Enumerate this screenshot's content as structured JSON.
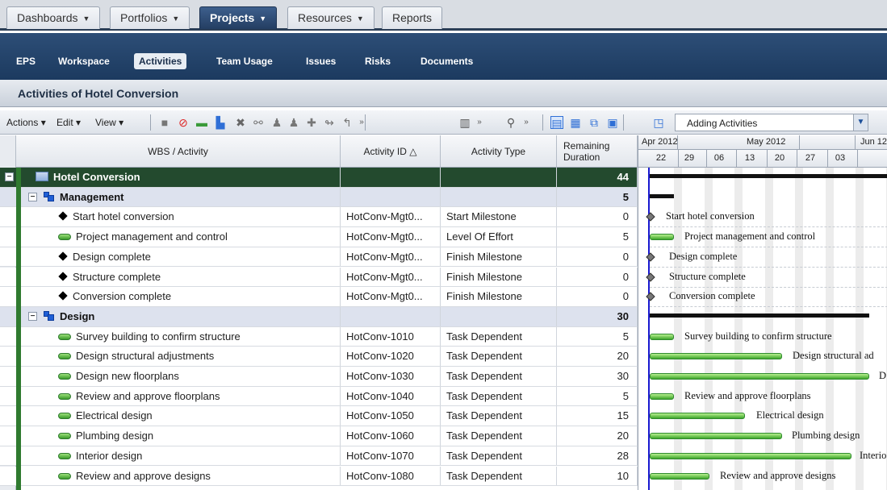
{
  "top_tabs": [
    {
      "label": "Dashboards",
      "caret": "▼"
    },
    {
      "label": "Portfolios",
      "caret": "▼"
    },
    {
      "label": "Projects",
      "caret": "▼"
    },
    {
      "label": "Resources",
      "caret": "▼"
    },
    {
      "label": "Reports",
      "caret": ""
    }
  ],
  "sub_nav": [
    "EPS",
    "Workspace",
    "Activities",
    "Team Usage",
    "Issues",
    "Risks",
    "Documents"
  ],
  "page_title": "Activities of Hotel Conversion",
  "toolbar": {
    "actions": "Actions",
    "edit": "Edit",
    "view": "View",
    "layout_value": "Adding Activities"
  },
  "columns": {
    "wbs": "WBS / Activity",
    "id": "Activity ID △",
    "type": "Activity Type",
    "rem": "Remaining Duration"
  },
  "rows": [
    {
      "kind": "project",
      "name": "Hotel Conversion",
      "id": "",
      "type": "",
      "dur": "44"
    },
    {
      "kind": "wbs",
      "name": "Management",
      "id": "",
      "type": "",
      "dur": "5"
    },
    {
      "kind": "ms",
      "name": "Start hotel conversion",
      "id": "HotConv-Mgt0...",
      "type": "Start Milestone",
      "dur": "0"
    },
    {
      "kind": "task",
      "name": "Project management and control",
      "id": "HotConv-Mgt0...",
      "type": "Level Of Effort",
      "dur": "5"
    },
    {
      "kind": "ms",
      "name": "Design complete",
      "id": "HotConv-Mgt0...",
      "type": "Finish Milestone",
      "dur": "0"
    },
    {
      "kind": "ms",
      "name": "Structure complete",
      "id": "HotConv-Mgt0...",
      "type": "Finish Milestone",
      "dur": "0"
    },
    {
      "kind": "ms",
      "name": "Conversion complete",
      "id": "HotConv-Mgt0...",
      "type": "Finish Milestone",
      "dur": "0"
    },
    {
      "kind": "wbs",
      "name": "Design",
      "id": "",
      "type": "",
      "dur": "30"
    },
    {
      "kind": "task",
      "name": "Survey building to confirm structure",
      "id": "HotConv-1010",
      "type": "Task Dependent",
      "dur": "5"
    },
    {
      "kind": "task",
      "name": "Design structural adjustments",
      "id": "HotConv-1020",
      "type": "Task Dependent",
      "dur": "20"
    },
    {
      "kind": "task",
      "name": "Design new floorplans",
      "id": "HotConv-1030",
      "type": "Task Dependent",
      "dur": "30"
    },
    {
      "kind": "task",
      "name": "Review and approve floorplans",
      "id": "HotConv-1040",
      "type": "Task Dependent",
      "dur": "5"
    },
    {
      "kind": "task",
      "name": "Electrical design",
      "id": "HotConv-1050",
      "type": "Task Dependent",
      "dur": "15"
    },
    {
      "kind": "task",
      "name": "Plumbing design",
      "id": "HotConv-1060",
      "type": "Task Dependent",
      "dur": "20"
    },
    {
      "kind": "task",
      "name": "Interior design",
      "id": "HotConv-1070",
      "type": "Task Dependent",
      "dur": "28"
    },
    {
      "kind": "task",
      "name": "Review and approve designs",
      "id": "HotConv-1080",
      "type": "Task Dependent",
      "dur": "10"
    }
  ],
  "gantt": {
    "months": [
      "Apr 2012",
      "May 2012",
      "Jun 12"
    ],
    "days": [
      "22",
      "29",
      "06",
      "13",
      "20",
      "27",
      "03"
    ],
    "labels": [
      "Start hotel conversion",
      "Project management and control",
      "Design complete",
      "Structure complete",
      "Conversion complete",
      "Survey building to confirm structure",
      "Design structural ad",
      "D",
      "Review and approve floorplans",
      "Electrical design",
      "Plumbing design",
      "Interio",
      "Review and approve designs"
    ]
  }
}
